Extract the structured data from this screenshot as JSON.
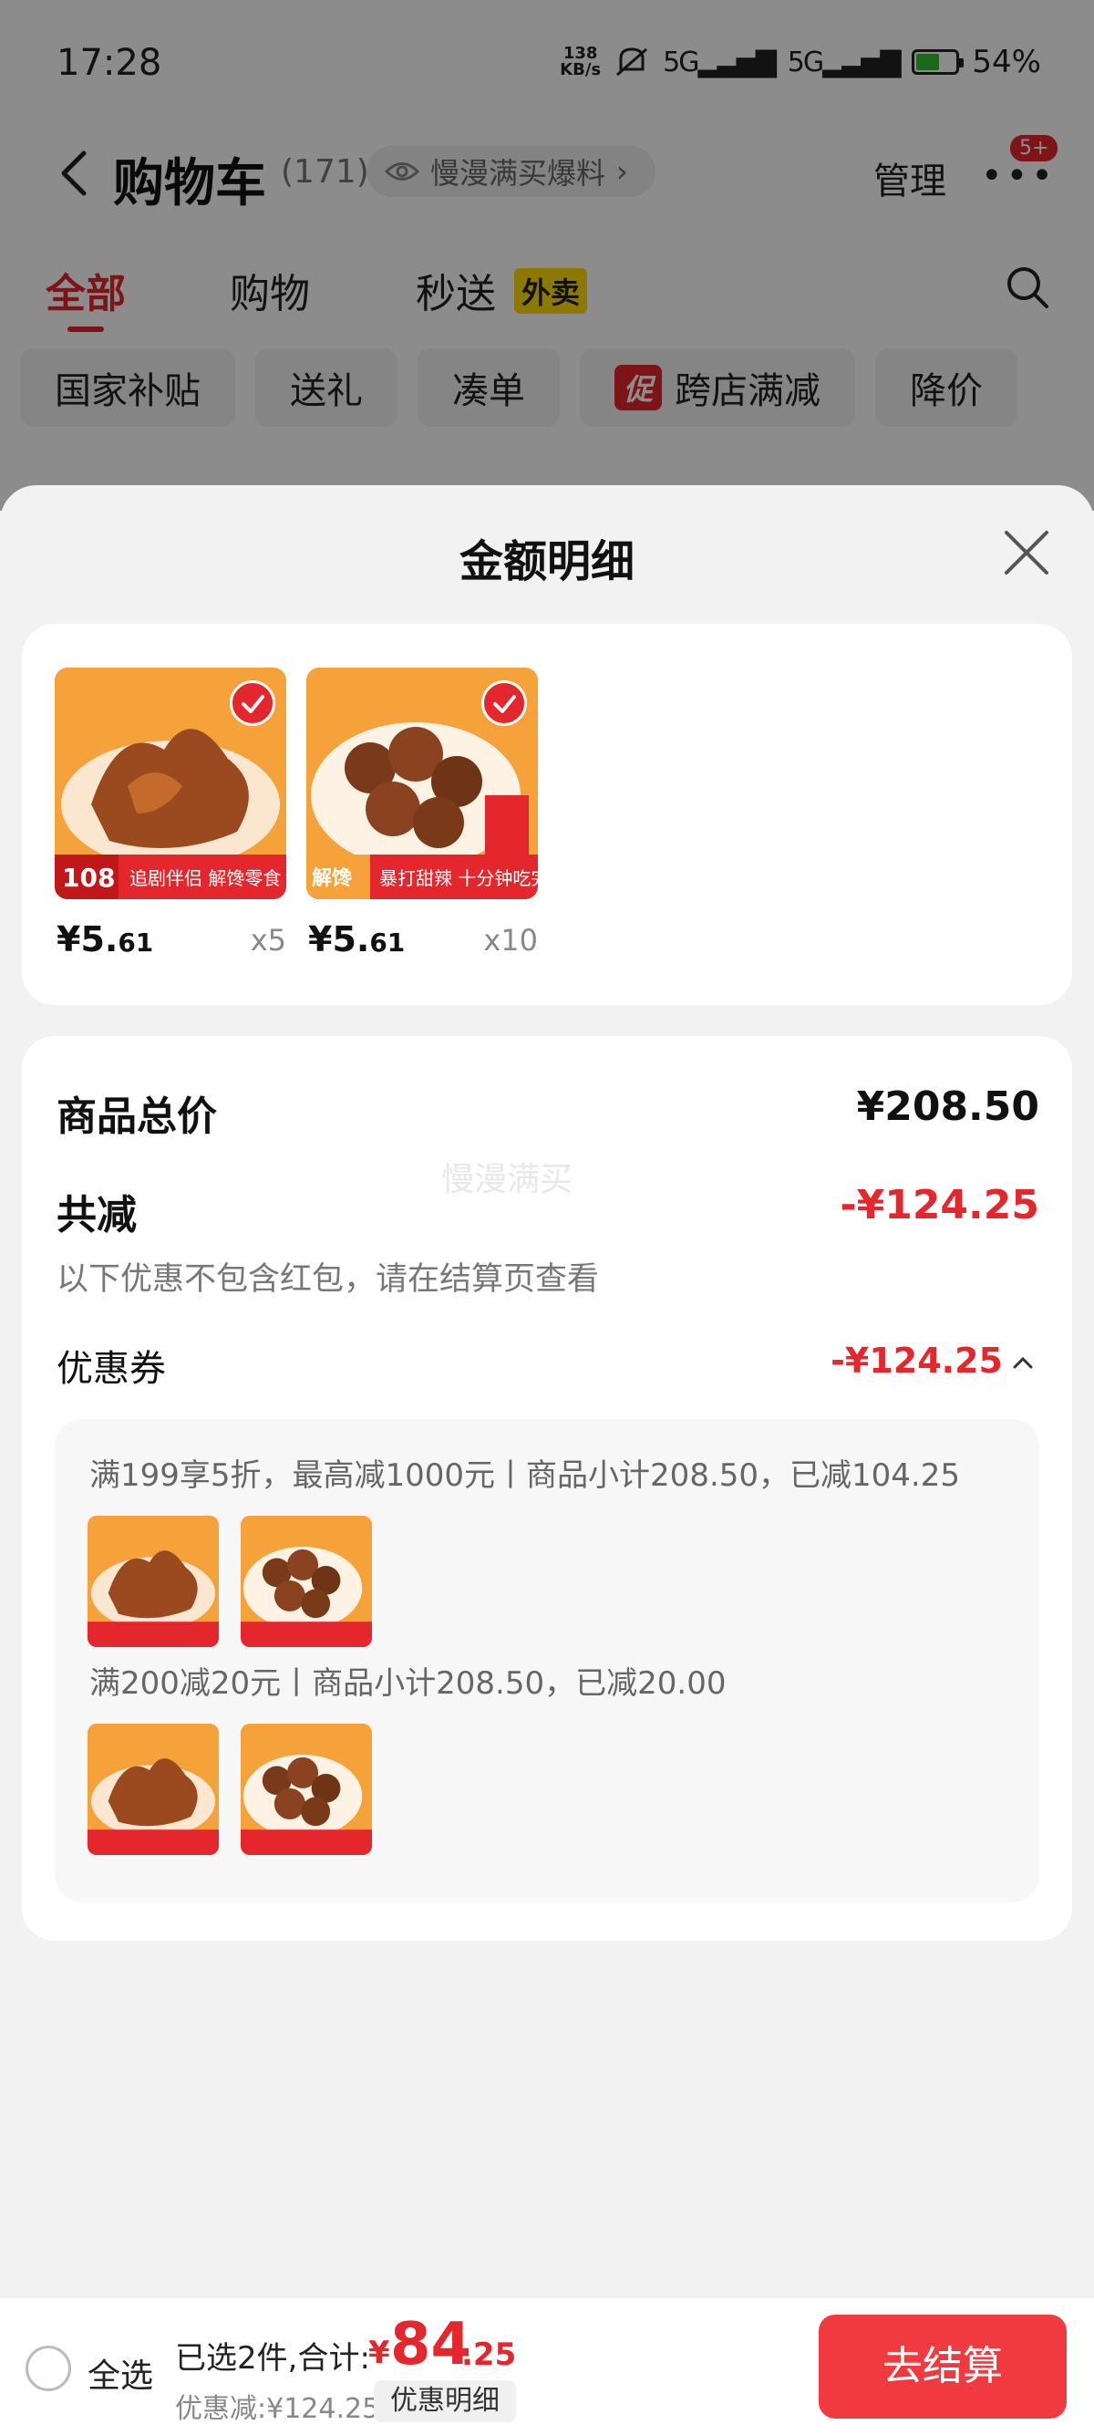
{
  "status_bar": {
    "time": "17:28",
    "net_speed_value": "138",
    "net_speed_unit": "KB/s",
    "signal1": "5G",
    "signal2": "5G",
    "battery_text": "54%",
    "battery_level": 0.54
  },
  "header": {
    "title": "购物车",
    "count": "(171)",
    "explore_label": "慢漫满买爆料",
    "explore_arrow": "›",
    "manage_label": "管理",
    "more_badge": "5+"
  },
  "tabs": {
    "all": "全部",
    "shopping": "购物",
    "fast": "秒送",
    "takeout_tag": "外卖"
  },
  "chips": {
    "subsidy": "国家补贴",
    "gift": "送礼",
    "combine": "凑单",
    "promo_tag": "促",
    "cross_store": "跨店满减",
    "price_drop": "降价"
  },
  "sheet": {
    "title": "金额明细",
    "products": [
      {
        "price_int": "¥5.",
        "price_dec": "61",
        "qty": "x5",
        "icon": "duck-wing-product"
      },
      {
        "price_int": "¥5.",
        "price_dec": "61",
        "qty": "x10",
        "icon": "duck-neck-product"
      }
    ],
    "summary": {
      "total_label": "商品总价",
      "total_value": "¥208.50",
      "reduce_label": "共减",
      "reduce_value": "-¥124.25",
      "hint": "以下优惠不包含红包，请在结算页查看",
      "watermark": "慢漫满买",
      "coupon_label": "优惠券",
      "coupon_value": "-¥124.25",
      "coupon_lines": [
        "满199享5折，最高减1000元丨商品小计208.50，已减104.25",
        "满200减20元丨商品小计208.50，已减20.00"
      ]
    }
  },
  "bottom": {
    "select_all": "全选",
    "selected_text": "已选2件,合计:",
    "total_prefix": "¥",
    "total_int": "84",
    "total_dec": ".25",
    "saved_text": "优惠减:¥124.25",
    "detail_button": "优惠明细",
    "checkout_button": "去结算"
  },
  "colors": {
    "accent_red": "#e4262d",
    "checkout_red": "#f03a3f",
    "takeout_yellow": "#ffdf00"
  }
}
